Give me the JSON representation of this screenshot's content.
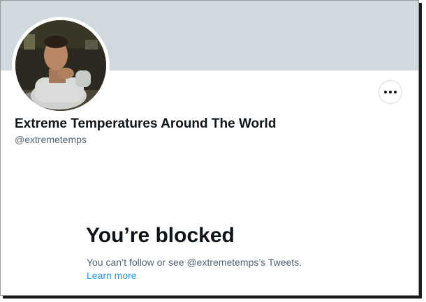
{
  "profile": {
    "display_name": "Extreme Temperatures Around The World",
    "handle": "@extremetemps",
    "more_button_label": "More"
  },
  "blocked": {
    "title": "You’re blocked",
    "message": "You can’t follow or see @extremetemps’s Tweets.",
    "link_label": "Learn more"
  },
  "colors": {
    "banner": "#cfd9de",
    "text_primary": "#0f1419",
    "text_secondary": "#536471",
    "link": "#1d9bf0"
  },
  "icons": {
    "more": "more-horizontal-icon"
  }
}
